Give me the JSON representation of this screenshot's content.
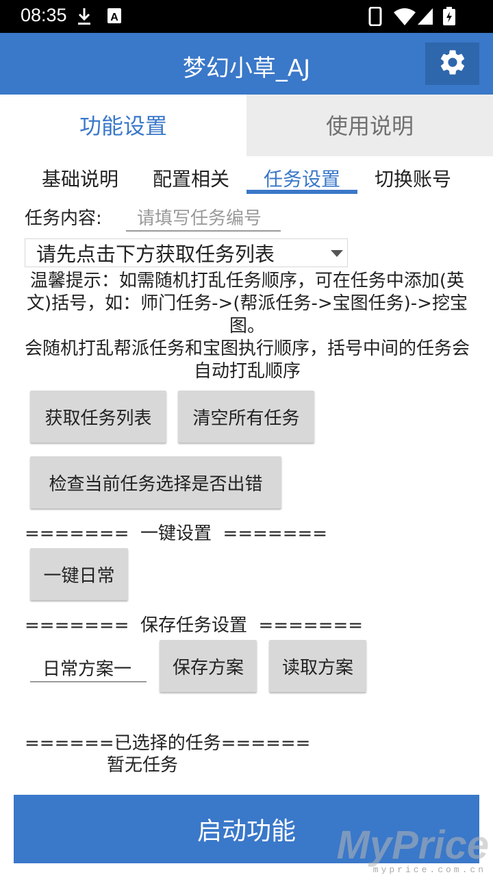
{
  "status_bar": {
    "time": "08:35",
    "icons": [
      "download-icon",
      "keyboard-a-icon",
      "phone-icon",
      "wifi-icon",
      "signal-icon",
      "battery-charging-icon"
    ]
  },
  "app_bar": {
    "title": "梦幻小草_AJ",
    "settings_icon": "gear-icon"
  },
  "main_tabs": [
    {
      "label": "功能设置",
      "active": true
    },
    {
      "label": "使用说明",
      "active": false
    }
  ],
  "sub_tabs": [
    {
      "label": "基础说明",
      "active": false
    },
    {
      "label": "配置相关",
      "active": false
    },
    {
      "label": "任务设置",
      "active": true
    },
    {
      "label": "切换账号",
      "active": false
    }
  ],
  "task_form": {
    "content_label": "任务内容:",
    "content_placeholder": "请填写任务编号",
    "task_select_value": "请先点击下方获取任务列表"
  },
  "tip": {
    "line1": "温馨提示：如需随机打乱任务顺序，可在任务中添加(英文)括号，如：师门任务->(帮派任务->宝图任务)->挖宝图。",
    "line2": "会随机打乱帮派任务和宝图执行顺序，括号中间的任务会自动打乱顺序"
  },
  "buttons": {
    "get_task_list": "获取任务列表",
    "clear_all_tasks": "清空所有任务",
    "check_selection": "检查当前任务选择是否出错",
    "one_key_daily": "一键日常",
    "save_plan": "保存方案",
    "load_plan": "读取方案",
    "start": "启动功能"
  },
  "sections": {
    "one_key": "=======  一键设置  =======",
    "save_task": "=======  保存任务设置  =======",
    "selected": "======已选择的任务======"
  },
  "plan_name_value": "日常方案一",
  "selected_tasks_empty": "暂无任务",
  "watermark": {
    "main": "MyPrice",
    "sub": "myprice.com.cn"
  },
  "colors": {
    "primary": "#3a78c9",
    "primary_dark": "#2f67ad",
    "button_gray": "#d8d8d8",
    "inactive_tab_bg": "#ececec"
  }
}
